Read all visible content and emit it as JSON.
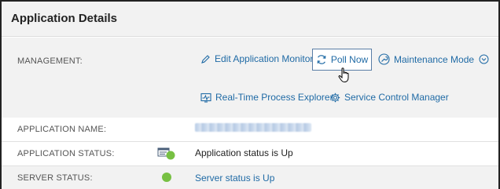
{
  "panel": {
    "title": "Application Details"
  },
  "management": {
    "label": "MANAGEMENT:",
    "edit_monitor": "Edit Application Monitor",
    "poll_now": "Poll Now",
    "maintenance_mode": "Maintenance Mode",
    "process_explorer": "Real-Time Process Explorer",
    "service_control": "Service Control Manager"
  },
  "application_name": {
    "label": "APPLICATION NAME:"
  },
  "application_status": {
    "label": "APPLICATION STATUS:",
    "value": "Application status is Up",
    "status_color": "#77c043"
  },
  "server_status": {
    "label": "SERVER STATUS:",
    "value": "Server status is Up",
    "status_color": "#77c043"
  },
  "colors": {
    "link": "#1f6aa5",
    "header_bg": "#f2f2f2",
    "row_shade": "#f2f2f2"
  }
}
